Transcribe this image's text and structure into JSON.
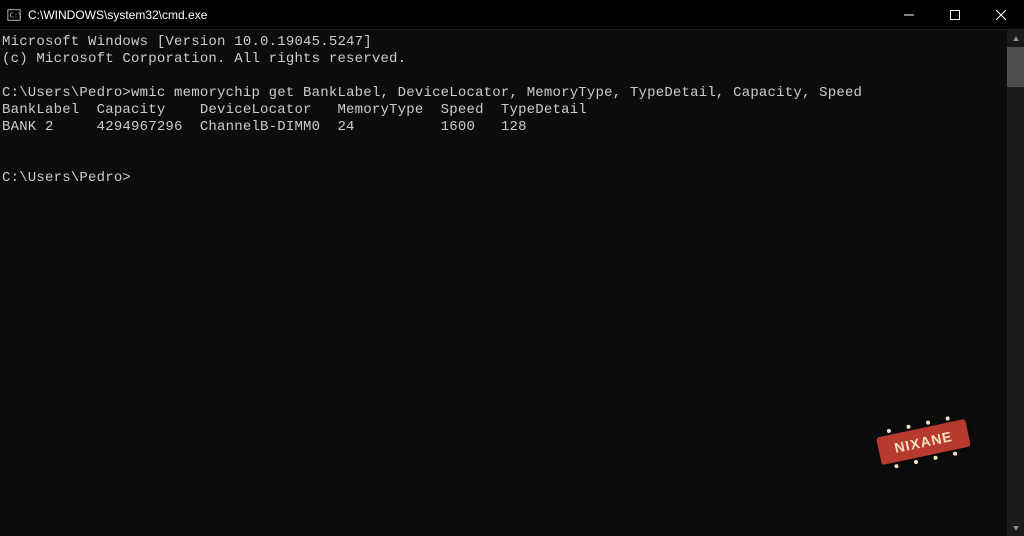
{
  "titlebar": {
    "title": "C:\\WINDOWS\\system32\\cmd.exe"
  },
  "terminal": {
    "banner_line1": "Microsoft Windows [Version 10.0.19045.5247]",
    "banner_line2": "(c) Microsoft Corporation. All rights reserved.",
    "prompt1_path": "C:\\Users\\Pedro>",
    "command1": "wmic memorychip get BankLabel, DeviceLocator, MemoryType, TypeDetail, Capacity, Speed",
    "table_header": "BankLabel  Capacity    DeviceLocator   MemoryType  Speed  TypeDetail",
    "table_row1": "BANK 2     4294967296  ChannelB-DIMM0  24          1600   128",
    "prompt2_path": "C:\\Users\\Pedro>"
  },
  "watermark": {
    "text": "NIXANE"
  }
}
